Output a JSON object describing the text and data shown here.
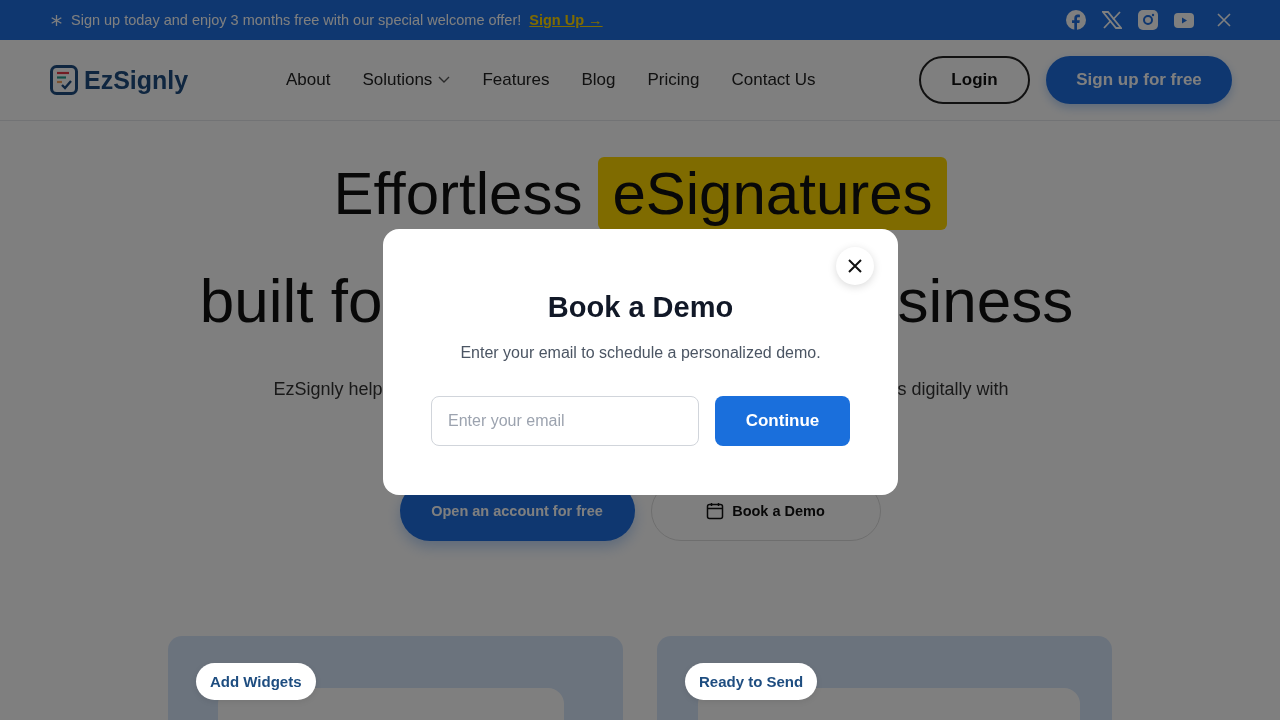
{
  "banner": {
    "text": "Sign up today and enjoy 3 months free with our special welcome offer!",
    "link": "Sign Up →"
  },
  "header": {
    "logo": "EzSignly",
    "nav": [
      {
        "label": "About",
        "dropdown": false
      },
      {
        "label": "Solutions",
        "dropdown": true
      },
      {
        "label": "Features",
        "dropdown": false
      },
      {
        "label": "Blog",
        "dropdown": false
      },
      {
        "label": "Pricing",
        "dropdown": false
      },
      {
        "label": "Contact Us",
        "dropdown": false
      }
    ],
    "login": "Login",
    "signup": "Sign up for free"
  },
  "hero": {
    "line1": "Effortless",
    "highlight": "eSignatures",
    "line2_left": "built fo",
    "line2_right": "siness",
    "description_left": "EzSignly help",
    "description_right": "s digitally with",
    "primary_button": "Open an account for free",
    "secondary_button": "Book a Demo"
  },
  "cards": [
    {
      "label": "Add Widgets"
    },
    {
      "label": "Ready to Send"
    }
  ],
  "modal": {
    "title": "Book a Demo",
    "subtitle": "Enter your email to schedule a personalized demo.",
    "email_placeholder": "Enter your email",
    "continue_button": "Continue"
  }
}
